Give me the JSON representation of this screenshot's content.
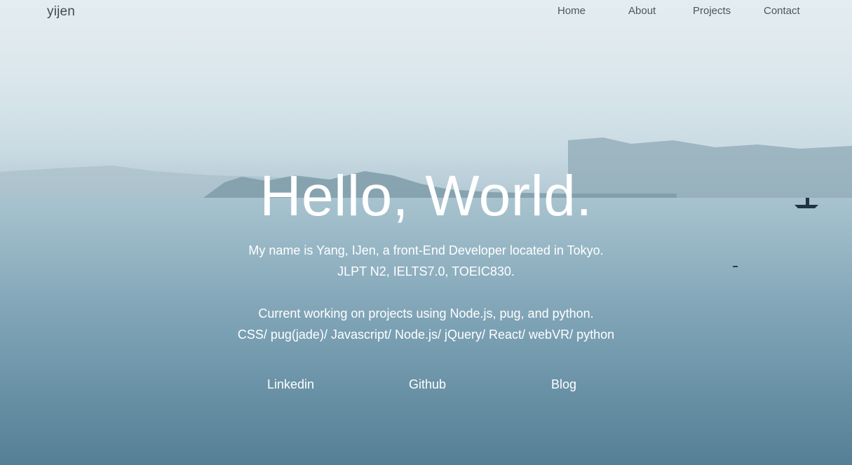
{
  "header": {
    "brand": "yijen",
    "nav": [
      "Home",
      "About",
      "Projects",
      "Contact"
    ]
  },
  "hero": {
    "headline": "Hello, World.",
    "intro_lines": [
      "My name is Yang, IJen, a front-End Developer located in Tokyo.",
      "JLPT N2, IELTS7.0, TOEIC830."
    ],
    "work_lines": [
      "Current working on projects using Node.js, pug, and python.",
      "CSS/ pug(jade)/ Javascript/ Node.js/ jQuery/ React/ webVR/ python"
    ],
    "links": [
      "Linkedin",
      "Github",
      "Blog"
    ]
  },
  "colors": {
    "text_light": "#ffffff",
    "nav_text": "#4a565e",
    "sky": "#d9e6ec",
    "water": "#5b8499"
  }
}
